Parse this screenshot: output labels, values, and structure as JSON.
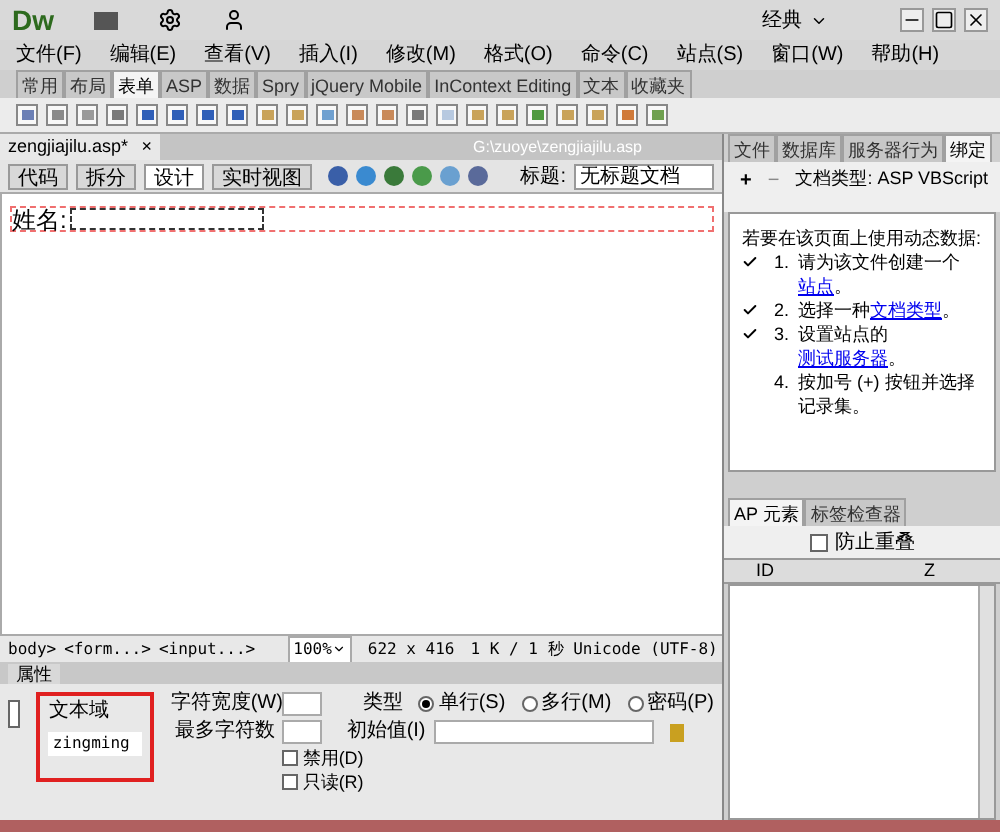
{
  "window": {
    "app": "Dw",
    "workspace": "经典"
  },
  "menu": [
    "文件(F)",
    "编辑(E)",
    "查看(V)",
    "插入(I)",
    "修改(M)",
    "格式(O)",
    "命令(C)",
    "站点(S)",
    "窗口(W)",
    "帮助(H)"
  ],
  "insert_tabs": [
    {
      "label": "常用",
      "selected": false
    },
    {
      "label": "布局",
      "selected": false
    },
    {
      "label": "表单",
      "selected": true
    },
    {
      "label": "ASP",
      "selected": false
    },
    {
      "label": "数据",
      "selected": false
    },
    {
      "label": "Spry",
      "selected": false
    },
    {
      "label": "jQuery Mobile",
      "selected": false
    },
    {
      "label": "InContext Editing",
      "selected": false
    },
    {
      "label": "文本",
      "selected": false
    },
    {
      "label": "收藏夹",
      "selected": false
    }
  ],
  "document": {
    "tab": "zengjiajilu.asp*",
    "close": "×",
    "path": "G:\\zuoye\\zengjiajilu.asp",
    "views": [
      {
        "label": "代码",
        "selected": false
      },
      {
        "label": "拆分",
        "selected": false
      },
      {
        "label": "设计",
        "selected": true
      },
      {
        "label": "实时视图",
        "selected": false
      }
    ],
    "title_label": "标题:",
    "title_value": "无标题文档"
  },
  "design": {
    "label": "姓名:"
  },
  "status_bar": {
    "tags": [
      "body>",
      "<form...>",
      "<input...>"
    ],
    "zoom": "100%",
    "size": "622 x 416",
    "info": "1 K / 1 秒 Unicode (UTF-8)"
  },
  "properties": {
    "title": "属性",
    "field_label": "文本域",
    "field_name": "zingming",
    "char_width": "字符宽度(W)",
    "max_chars": "最多字符数",
    "type_label": "类型",
    "types": [
      {
        "label": "单行(S)",
        "selected": true
      },
      {
        "label": "多行(M)",
        "selected": false
      },
      {
        "label": "密码(P)",
        "selected": false
      }
    ],
    "init_label": "初始值(I)",
    "options": [
      {
        "label": "禁用(D)",
        "checked": false
      },
      {
        "label": "只读(R)",
        "checked": false
      }
    ]
  },
  "bindings": {
    "tabs": [
      {
        "label": "文件",
        "selected": false
      },
      {
        "label": "数据库",
        "selected": false
      },
      {
        "label": "服务器行为",
        "selected": false
      },
      {
        "label": "绑定",
        "selected": true
      }
    ],
    "plus": "+",
    "minus": "−",
    "doctype": "文档类型: ASP VBScript",
    "intro": "若要在该页面上使用动态数据:",
    "steps": [
      {
        "num": "1.",
        "text": "请为该文件创建一个",
        "link": "站点",
        "after": "。",
        "checked": true
      },
      {
        "num": "2.",
        "text": "选择一种",
        "link": "文档类型",
        "after": "。",
        "checked": true
      },
      {
        "num": "3.",
        "text": "设置站点的",
        "link": "测试服务器",
        "after": "。",
        "checked": true
      },
      {
        "num": "4.",
        "text": "按加号 (+) 按钮并选择记录集。",
        "checked": false
      }
    ]
  },
  "ap_panel": {
    "tabs": [
      {
        "label": "AP 元素",
        "selected": true
      },
      {
        "label": "标签检查器",
        "selected": false
      }
    ],
    "prevent_overlap": {
      "label": "防止重叠",
      "checked": false
    },
    "columns": [
      "ID",
      "Z"
    ]
  }
}
